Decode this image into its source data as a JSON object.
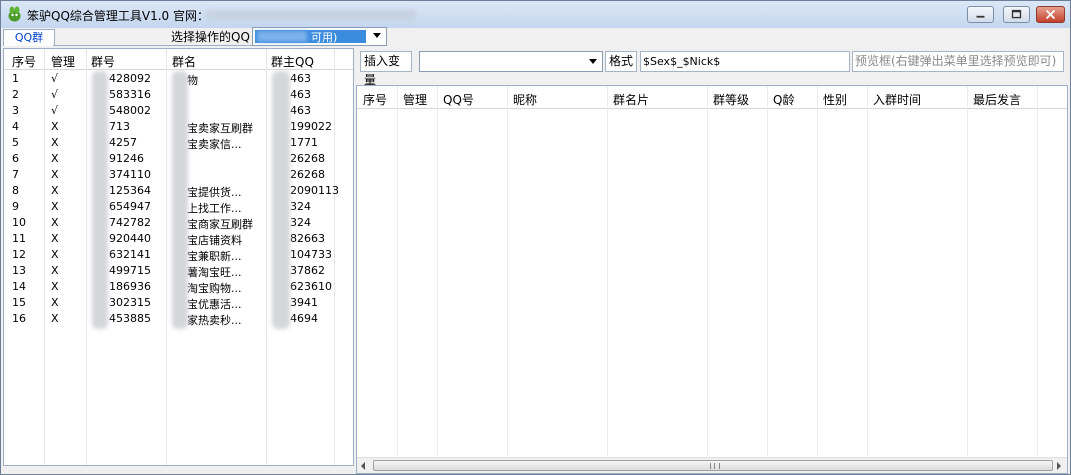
{
  "window": {
    "title": "笨驴QQ综合管理工具V1.0 官网：",
    "minimize_icon": "minimize-icon",
    "maximize_icon": "maximize-icon",
    "close_icon": "close-icon"
  },
  "left": {
    "tab_label": "QQ群",
    "select_label": "选择操作的QQ",
    "qq_selected": "可用)",
    "columns": [
      "序号",
      "管理",
      "群号",
      "群名",
      "群主QQ"
    ],
    "rows": [
      {
        "no": "1",
        "admin": "√",
        "group_id": "428092",
        "group_name": "物",
        "owner_qq": "463"
      },
      {
        "no": "2",
        "admin": "√",
        "group_id": "583316",
        "group_name": "",
        "owner_qq": "463"
      },
      {
        "no": "3",
        "admin": "√",
        "group_id": "548002",
        "group_name": "",
        "owner_qq": "463"
      },
      {
        "no": "4",
        "admin": "X",
        "group_id": "713",
        "group_name": "宝卖家互刷群",
        "owner_qq": "199022"
      },
      {
        "no": "5",
        "admin": "X",
        "group_id": "4257",
        "group_name": "宝卖家信...",
        "owner_qq": "1771"
      },
      {
        "no": "6",
        "admin": "X",
        "group_id": "91246",
        "group_name": "",
        "owner_qq": "26268"
      },
      {
        "no": "7",
        "admin": "X",
        "group_id": "374110",
        "group_name": "",
        "owner_qq": "26268"
      },
      {
        "no": "8",
        "admin": "X",
        "group_id": "125364",
        "group_name": "宝提供货...",
        "owner_qq": "2090113"
      },
      {
        "no": "9",
        "admin": "X",
        "group_id": "654947",
        "group_name": "上找工作...",
        "owner_qq": "324"
      },
      {
        "no": "10",
        "admin": "X",
        "group_id": "742782",
        "group_name": "宝商家互刷群",
        "owner_qq": "324"
      },
      {
        "no": "11",
        "admin": "X",
        "group_id": "920440",
        "group_name": "宝店铺资料",
        "owner_qq": "82663"
      },
      {
        "no": "12",
        "admin": "X",
        "group_id": "632141",
        "group_name": "宝兼职新...",
        "owner_qq": "104733"
      },
      {
        "no": "13",
        "admin": "X",
        "group_id": "499715",
        "group_name": "薯淘宝旺...",
        "owner_qq": "37862"
      },
      {
        "no": "14",
        "admin": "X",
        "group_id": "186936",
        "group_name": "淘宝购物...",
        "owner_qq": "623610"
      },
      {
        "no": "15",
        "admin": "X",
        "group_id": "302315",
        "group_name": "宝优惠活...",
        "owner_qq": "3941"
      },
      {
        "no": "16",
        "admin": "X",
        "group_id": "453885",
        "group_name": "家热卖秒...",
        "owner_qq": "4694"
      }
    ]
  },
  "right": {
    "insert_var_label": "插入变量",
    "insert_var_value": "",
    "format_label": "格式",
    "format_value": "$Sex$_$Nick$",
    "preview_placeholder": "预览框(右键弹出菜单里选择预览即可)",
    "columns": [
      "序号",
      "管理",
      "QQ号",
      "昵称",
      "群名片",
      "群等级",
      "Q龄",
      "性别",
      "入群时间",
      "最后发言"
    ]
  }
}
